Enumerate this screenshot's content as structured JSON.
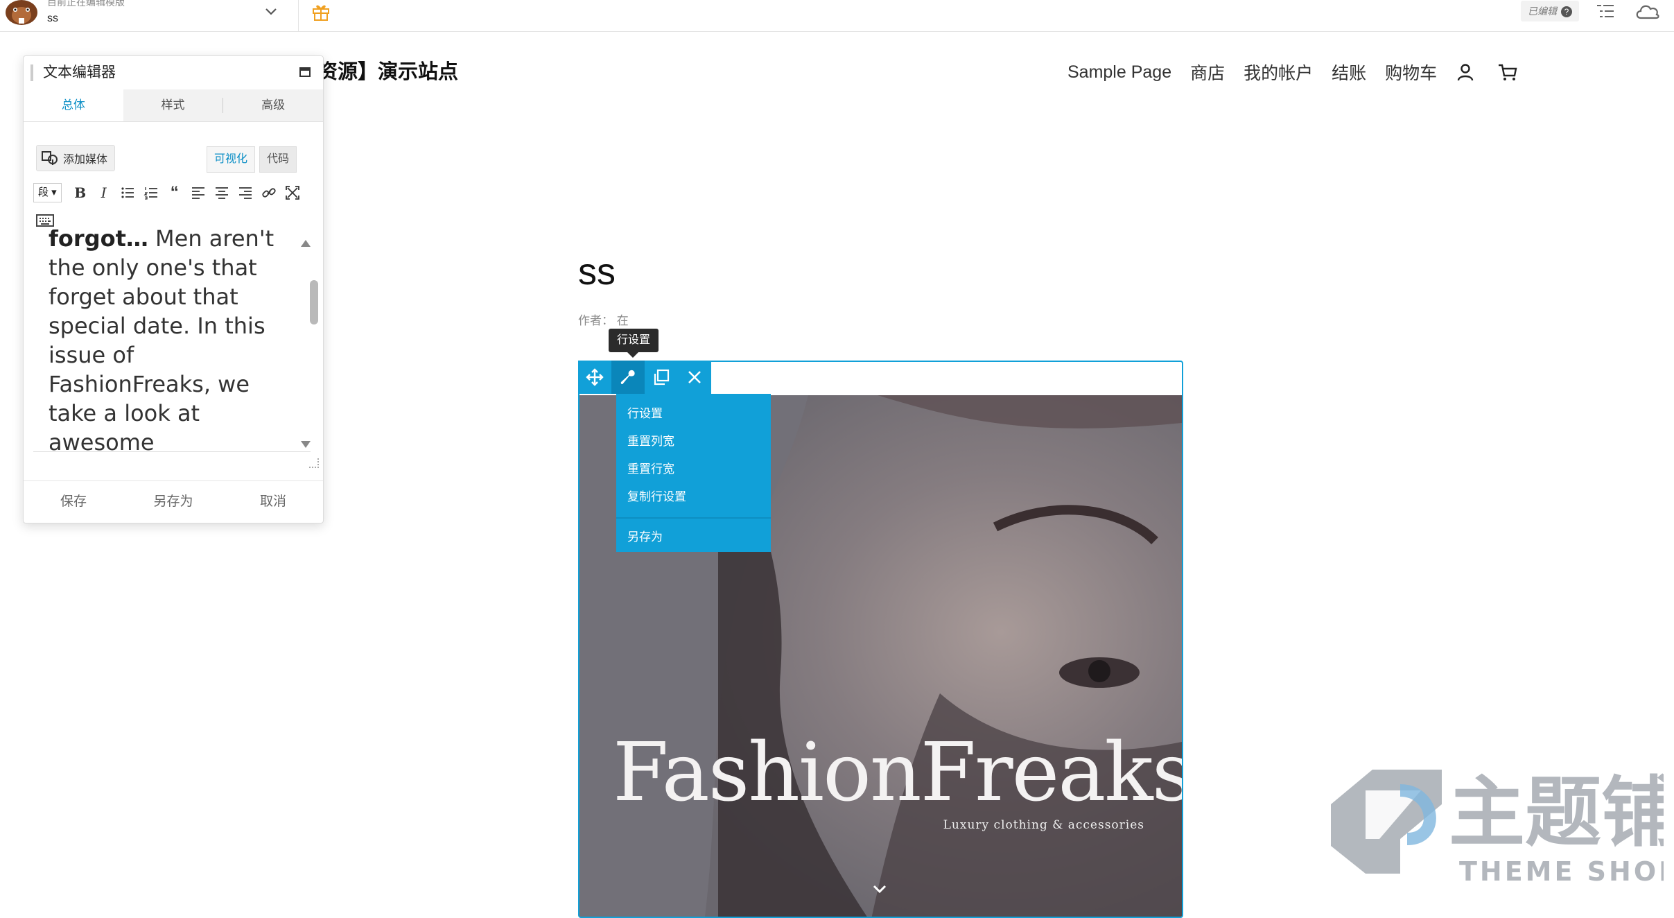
{
  "topbar": {
    "status_text": "目前正在编辑模版",
    "layout_name": "ss",
    "edited_label": "已编辑",
    "help_glyph": "?"
  },
  "site": {
    "title": "资源】演示站点",
    "nav": [
      "Sample Page",
      "商店",
      "我的帐户",
      "结账",
      "购物车"
    ]
  },
  "post": {
    "title": "ss",
    "meta": "作者： 在"
  },
  "row_toolbar": {
    "tooltip": "行设置",
    "buttons": [
      "move-icon",
      "wrench-icon",
      "duplicate-icon",
      "close-icon"
    ],
    "menu": [
      "行设置",
      "重置列宽",
      "重置行宽",
      "复制行设置",
      "另存为"
    ]
  },
  "hero": {
    "title": "FashionFreaks",
    "subtitle": "Luxury clothing & accessories"
  },
  "panel": {
    "title": "文本编辑器",
    "tabs": [
      "总体",
      "样式",
      "高级"
    ],
    "add_media": "添加媒体",
    "mode_visual": "可视化",
    "mode_code": "代码",
    "format_select": "段",
    "content_bold": "forgot…",
    "content_rest": " Men aren't the only one's that forget about that special date. In this issue of FashionFreaks, we take a look at awesome accessories",
    "footer": [
      "保存",
      "另存为",
      "取消"
    ]
  },
  "watermark": {
    "brand_cn": "主题铺",
    "brand_en": "THEME SHOP"
  },
  "colors": {
    "accent": "#11a0d8",
    "accent_dark": "#0a86ba",
    "tab_active": "#0c8fc6"
  }
}
